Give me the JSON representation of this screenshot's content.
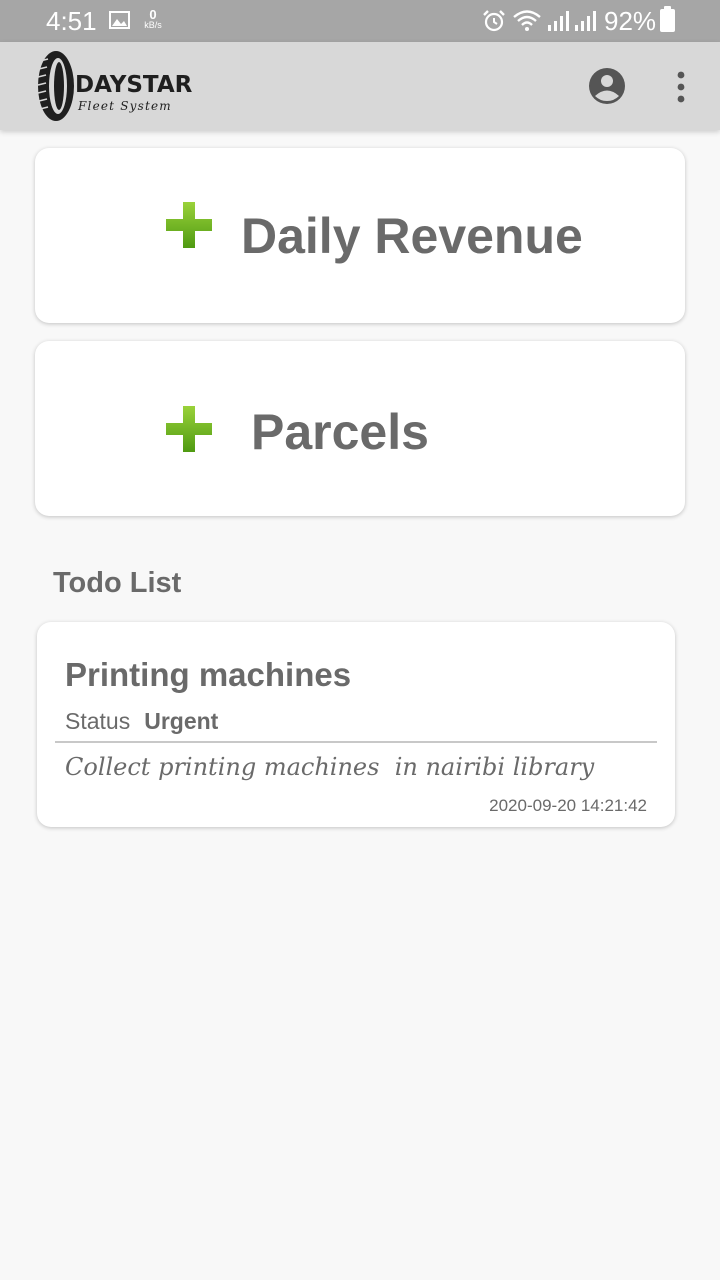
{
  "status_bar": {
    "time": "4:51",
    "net_speed_value": "0",
    "net_speed_unit": "kB/s",
    "battery_text": "92%",
    "icons": [
      "image-icon",
      "alarm-icon",
      "wifi-icon",
      "signal-icon",
      "signal-icon",
      "battery-icon"
    ]
  },
  "app_bar": {
    "logo_name": "DAYSTAR",
    "logo_subtitle": "Fleet System",
    "icons": [
      "account-circle-icon",
      "more-vertical-icon"
    ]
  },
  "actions": [
    {
      "label": "Daily Revenue",
      "icon": "plus-icon"
    },
    {
      "label": "Parcels",
      "icon": "plus-icon"
    }
  ],
  "todo": {
    "heading": "Todo List",
    "items": [
      {
        "title": "Printing machines",
        "status_label": "Status",
        "status_value": "Urgent",
        "description": "Collect printing machines  in nairibi library",
        "timestamp": "2020-09-20 14:21:42"
      }
    ]
  },
  "colors": {
    "status_bar": "#a6a6a6",
    "app_bar": "#d8d8d8",
    "background": "#f8f8f8",
    "text": "#6a6a6a",
    "plus_green": "#6ab01f"
  }
}
